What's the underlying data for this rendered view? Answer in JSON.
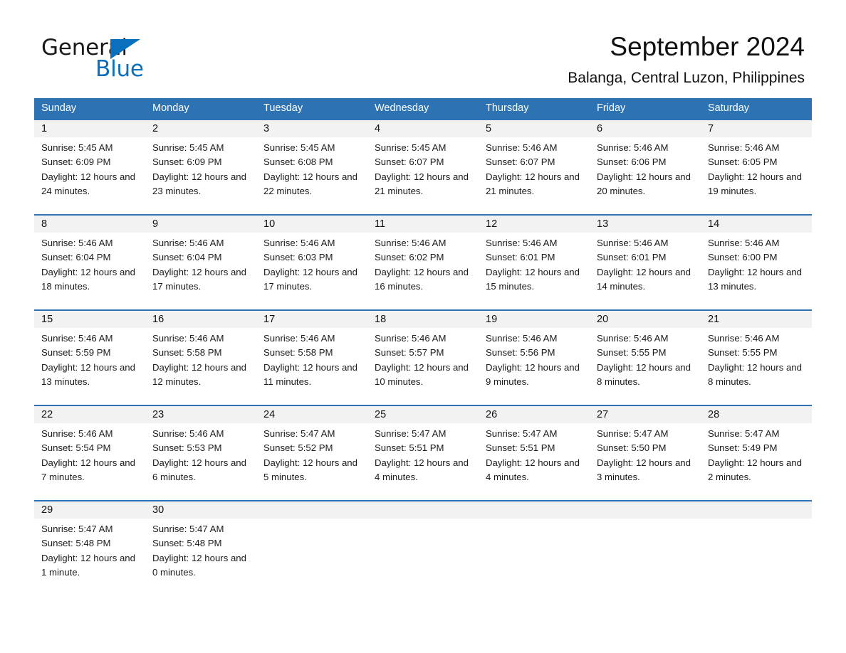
{
  "brand": {
    "name_part1": "General",
    "name_part2": "Blue",
    "triangle_icon": "triangle-icon",
    "accent_color": "#0a6fbd"
  },
  "header": {
    "title": "September 2024",
    "subtitle": "Balanga, Central Luzon, Philippines"
  },
  "calendar": {
    "header_bg": "#2d72b3",
    "date_band_bg": "#f2f2f2",
    "weekdays": [
      "Sunday",
      "Monday",
      "Tuesday",
      "Wednesday",
      "Thursday",
      "Friday",
      "Saturday"
    ],
    "weeks": [
      [
        {
          "date": "1",
          "sunrise": "Sunrise: 5:45 AM",
          "sunset": "Sunset: 6:09 PM",
          "daylight": "Daylight: 12 hours and 24 minutes."
        },
        {
          "date": "2",
          "sunrise": "Sunrise: 5:45 AM",
          "sunset": "Sunset: 6:09 PM",
          "daylight": "Daylight: 12 hours and 23 minutes."
        },
        {
          "date": "3",
          "sunrise": "Sunrise: 5:45 AM",
          "sunset": "Sunset: 6:08 PM",
          "daylight": "Daylight: 12 hours and 22 minutes."
        },
        {
          "date": "4",
          "sunrise": "Sunrise: 5:45 AM",
          "sunset": "Sunset: 6:07 PM",
          "daylight": "Daylight: 12 hours and 21 minutes."
        },
        {
          "date": "5",
          "sunrise": "Sunrise: 5:46 AM",
          "sunset": "Sunset: 6:07 PM",
          "daylight": "Daylight: 12 hours and 21 minutes."
        },
        {
          "date": "6",
          "sunrise": "Sunrise: 5:46 AM",
          "sunset": "Sunset: 6:06 PM",
          "daylight": "Daylight: 12 hours and 20 minutes."
        },
        {
          "date": "7",
          "sunrise": "Sunrise: 5:46 AM",
          "sunset": "Sunset: 6:05 PM",
          "daylight": "Daylight: 12 hours and 19 minutes."
        }
      ],
      [
        {
          "date": "8",
          "sunrise": "Sunrise: 5:46 AM",
          "sunset": "Sunset: 6:04 PM",
          "daylight": "Daylight: 12 hours and 18 minutes."
        },
        {
          "date": "9",
          "sunrise": "Sunrise: 5:46 AM",
          "sunset": "Sunset: 6:04 PM",
          "daylight": "Daylight: 12 hours and 17 minutes."
        },
        {
          "date": "10",
          "sunrise": "Sunrise: 5:46 AM",
          "sunset": "Sunset: 6:03 PM",
          "daylight": "Daylight: 12 hours and 17 minutes."
        },
        {
          "date": "11",
          "sunrise": "Sunrise: 5:46 AM",
          "sunset": "Sunset: 6:02 PM",
          "daylight": "Daylight: 12 hours and 16 minutes."
        },
        {
          "date": "12",
          "sunrise": "Sunrise: 5:46 AM",
          "sunset": "Sunset: 6:01 PM",
          "daylight": "Daylight: 12 hours and 15 minutes."
        },
        {
          "date": "13",
          "sunrise": "Sunrise: 5:46 AM",
          "sunset": "Sunset: 6:01 PM",
          "daylight": "Daylight: 12 hours and 14 minutes."
        },
        {
          "date": "14",
          "sunrise": "Sunrise: 5:46 AM",
          "sunset": "Sunset: 6:00 PM",
          "daylight": "Daylight: 12 hours and 13 minutes."
        }
      ],
      [
        {
          "date": "15",
          "sunrise": "Sunrise: 5:46 AM",
          "sunset": "Sunset: 5:59 PM",
          "daylight": "Daylight: 12 hours and 13 minutes."
        },
        {
          "date": "16",
          "sunrise": "Sunrise: 5:46 AM",
          "sunset": "Sunset: 5:58 PM",
          "daylight": "Daylight: 12 hours and 12 minutes."
        },
        {
          "date": "17",
          "sunrise": "Sunrise: 5:46 AM",
          "sunset": "Sunset: 5:58 PM",
          "daylight": "Daylight: 12 hours and 11 minutes."
        },
        {
          "date": "18",
          "sunrise": "Sunrise: 5:46 AM",
          "sunset": "Sunset: 5:57 PM",
          "daylight": "Daylight: 12 hours and 10 minutes."
        },
        {
          "date": "19",
          "sunrise": "Sunrise: 5:46 AM",
          "sunset": "Sunset: 5:56 PM",
          "daylight": "Daylight: 12 hours and 9 minutes."
        },
        {
          "date": "20",
          "sunrise": "Sunrise: 5:46 AM",
          "sunset": "Sunset: 5:55 PM",
          "daylight": "Daylight: 12 hours and 8 minutes."
        },
        {
          "date": "21",
          "sunrise": "Sunrise: 5:46 AM",
          "sunset": "Sunset: 5:55 PM",
          "daylight": "Daylight: 12 hours and 8 minutes."
        }
      ],
      [
        {
          "date": "22",
          "sunrise": "Sunrise: 5:46 AM",
          "sunset": "Sunset: 5:54 PM",
          "daylight": "Daylight: 12 hours and 7 minutes."
        },
        {
          "date": "23",
          "sunrise": "Sunrise: 5:46 AM",
          "sunset": "Sunset: 5:53 PM",
          "daylight": "Daylight: 12 hours and 6 minutes."
        },
        {
          "date": "24",
          "sunrise": "Sunrise: 5:47 AM",
          "sunset": "Sunset: 5:52 PM",
          "daylight": "Daylight: 12 hours and 5 minutes."
        },
        {
          "date": "25",
          "sunrise": "Sunrise: 5:47 AM",
          "sunset": "Sunset: 5:51 PM",
          "daylight": "Daylight: 12 hours and 4 minutes."
        },
        {
          "date": "26",
          "sunrise": "Sunrise: 5:47 AM",
          "sunset": "Sunset: 5:51 PM",
          "daylight": "Daylight: 12 hours and 4 minutes."
        },
        {
          "date": "27",
          "sunrise": "Sunrise: 5:47 AM",
          "sunset": "Sunset: 5:50 PM",
          "daylight": "Daylight: 12 hours and 3 minutes."
        },
        {
          "date": "28",
          "sunrise": "Sunrise: 5:47 AM",
          "sunset": "Sunset: 5:49 PM",
          "daylight": "Daylight: 12 hours and 2 minutes."
        }
      ],
      [
        {
          "date": "29",
          "sunrise": "Sunrise: 5:47 AM",
          "sunset": "Sunset: 5:48 PM",
          "daylight": "Daylight: 12 hours and 1 minute."
        },
        {
          "date": "30",
          "sunrise": "Sunrise: 5:47 AM",
          "sunset": "Sunset: 5:48 PM",
          "daylight": "Daylight: 12 hours and 0 minutes."
        },
        {
          "date": "",
          "sunrise": "",
          "sunset": "",
          "daylight": ""
        },
        {
          "date": "",
          "sunrise": "",
          "sunset": "",
          "daylight": ""
        },
        {
          "date": "",
          "sunrise": "",
          "sunset": "",
          "daylight": ""
        },
        {
          "date": "",
          "sunrise": "",
          "sunset": "",
          "daylight": ""
        },
        {
          "date": "",
          "sunrise": "",
          "sunset": "",
          "daylight": ""
        }
      ]
    ]
  }
}
